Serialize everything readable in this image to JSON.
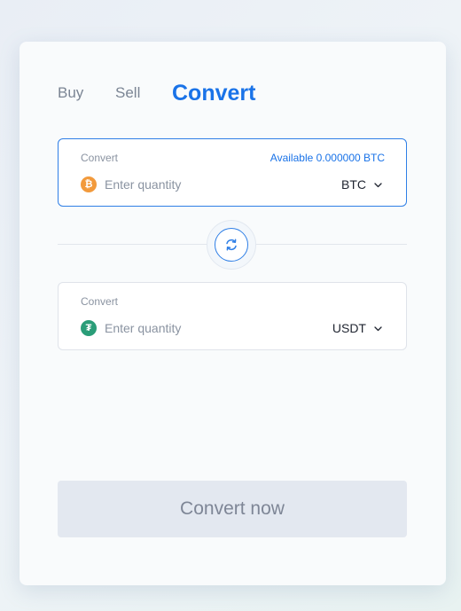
{
  "tabs": {
    "buy": "Buy",
    "sell": "Sell",
    "convert": "Convert"
  },
  "from": {
    "label": "Convert",
    "available": "Available 0.000000 BTC",
    "placeholder": "Enter quantity",
    "value": "",
    "currency": "BTC",
    "coin_icon": "bitcoin-icon",
    "coin_glyph": "₿",
    "coin_color": "#f29a3c"
  },
  "to": {
    "label": "Convert",
    "placeholder": "Enter quantity",
    "value": "",
    "currency": "USDT",
    "coin_icon": "tether-icon",
    "coin_glyph": "₮",
    "coin_color": "#2a9d78"
  },
  "swap_icon": "swap-icon",
  "cta": {
    "label": "Convert now",
    "enabled": false
  },
  "colors": {
    "accent": "#1a73e8",
    "muted_text": "#8a93a1",
    "button_disabled_bg": "#e3e8f0"
  }
}
